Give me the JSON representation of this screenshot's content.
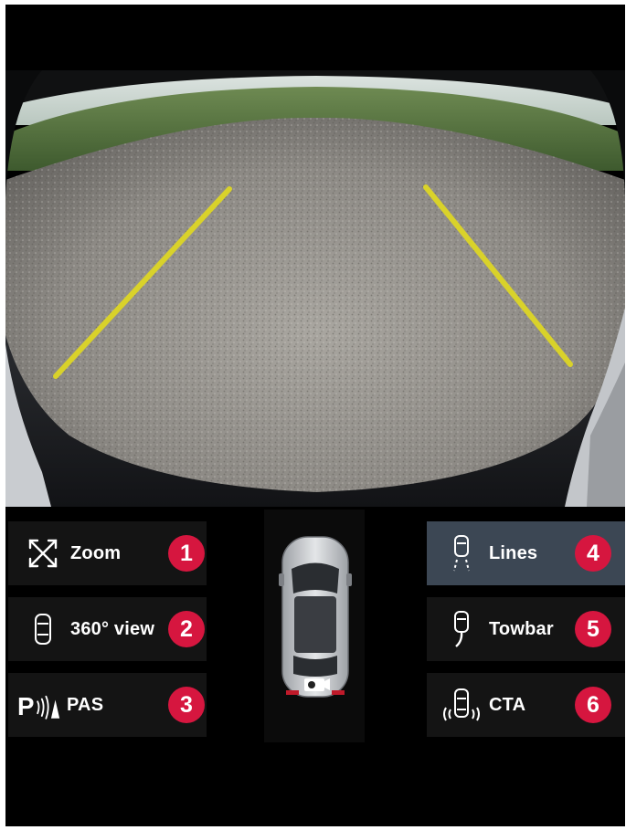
{
  "camera_view": {
    "guide_line_color": "#d9d22a"
  },
  "controls": {
    "left": [
      {
        "label": "Zoom",
        "number": "1",
        "icon": "zoom-expand-icon"
      },
      {
        "label": "360° view",
        "number": "2",
        "icon": "car-top-view-icon"
      },
      {
        "label": "PAS",
        "number": "3",
        "icon": "park-assist-sensor-icon",
        "icon_text": "P"
      }
    ],
    "right": [
      {
        "label": "Lines",
        "number": "4",
        "icon": "guide-lines-icon",
        "active": true
      },
      {
        "label": "Towbar",
        "number": "5",
        "icon": "towbar-icon"
      },
      {
        "label": "CTA",
        "number": "6",
        "icon": "cross-traffic-alert-icon"
      }
    ]
  },
  "colors": {
    "badge": "#d6163f",
    "active_button": "#3c4754",
    "button": "#141414"
  }
}
